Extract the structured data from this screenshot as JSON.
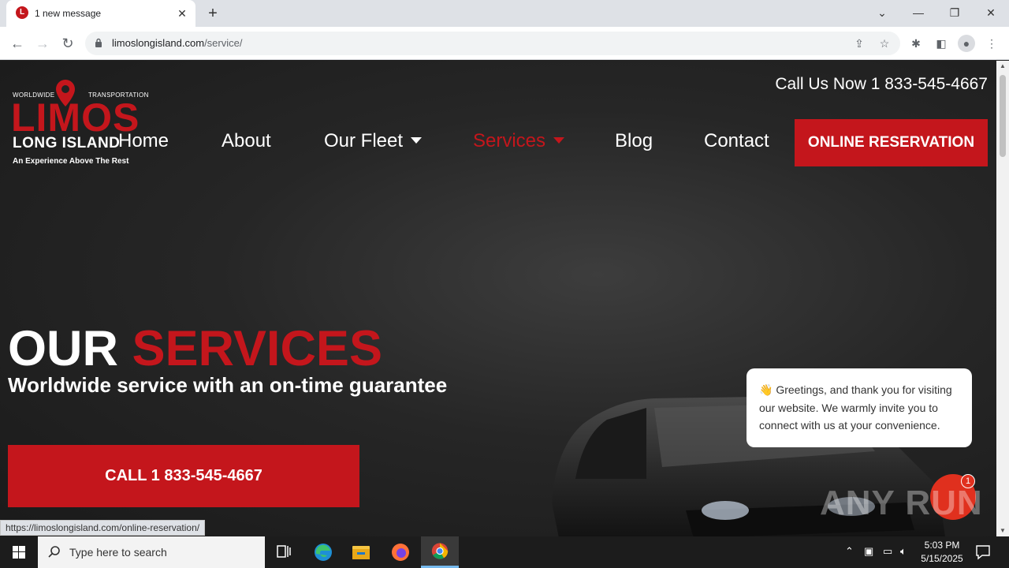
{
  "browser": {
    "tab_title": "1 new message",
    "tab_favicon_letter": "L",
    "url_domain": "limoslongisland.com",
    "url_path": "/service/",
    "status_url": "https://limoslongisland.com/online-reservation/"
  },
  "header": {
    "logo_top_left": "WORLDWIDE",
    "logo_top_right": "TRANSPORTATION",
    "logo_main": "LIMOS",
    "logo_sub": "LONG ISLAND",
    "logo_tagline": "An Experience Above The Rest",
    "call_now": "Call Us Now 1 833-545-4667"
  },
  "nav": {
    "home": "Home",
    "about": "About",
    "fleet": "Our Fleet",
    "services": "Services",
    "blog": "Blog",
    "contact": "Contact",
    "reserve": "ONLINE RESERVATION"
  },
  "hero": {
    "title_white": "OUR",
    "title_red": "SERVICES",
    "subtitle": "Worldwide service with an on-time guarantee",
    "call_button": "CALL 1 833-545-4667"
  },
  "chat": {
    "greeting": "👋 Greetings, and thank you for visiting our website. We warmly invite you to connect with us at your convenience.",
    "badge_count": "1"
  },
  "watermark": "ANY RUN",
  "taskbar": {
    "search_placeholder": "Type here to search",
    "time": "5:03 PM",
    "date": "5/15/2025"
  },
  "colors": {
    "brand_red": "#c4161c",
    "page_dark": "#202020"
  }
}
